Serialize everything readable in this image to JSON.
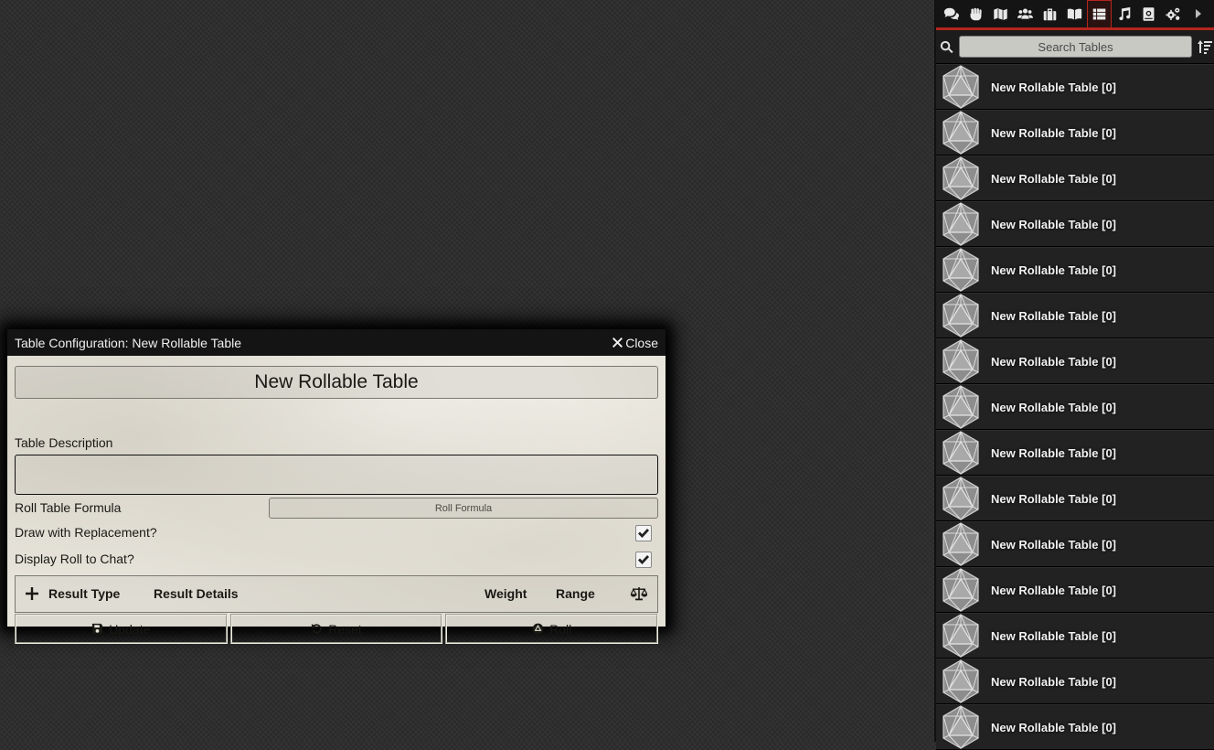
{
  "sidebar": {
    "tabs": [
      {
        "icon": "comments-icon",
        "name": "chat"
      },
      {
        "icon": "fist-icon",
        "name": "combat"
      },
      {
        "icon": "map-icon",
        "name": "scenes"
      },
      {
        "icon": "users-icon",
        "name": "actors"
      },
      {
        "icon": "suitcase-icon",
        "name": "items"
      },
      {
        "icon": "book-open-icon",
        "name": "journal"
      },
      {
        "icon": "th-list-icon",
        "name": "tables",
        "active": true
      },
      {
        "icon": "music-icon",
        "name": "playlists"
      },
      {
        "icon": "atlas-icon",
        "name": "compendium"
      },
      {
        "icon": "cogs-icon",
        "name": "settings"
      }
    ],
    "search": {
      "placeholder": "Search Tables",
      "value": ""
    },
    "entries": [
      {
        "label": "New Rollable Table [0]"
      },
      {
        "label": "New Rollable Table [0]"
      },
      {
        "label": "New Rollable Table [0]"
      },
      {
        "label": "New Rollable Table [0]"
      },
      {
        "label": "New Rollable Table [0]"
      },
      {
        "label": "New Rollable Table [0]"
      },
      {
        "label": "New Rollable Table [0]"
      },
      {
        "label": "New Rollable Table [0]"
      },
      {
        "label": "New Rollable Table [0]"
      },
      {
        "label": "New Rollable Table [0]"
      },
      {
        "label": "New Rollable Table [0]"
      },
      {
        "label": "New Rollable Table [0]"
      },
      {
        "label": "New Rollable Table [0]"
      },
      {
        "label": "New Rollable Table [0]"
      },
      {
        "label": "New Rollable Table [0]"
      }
    ]
  },
  "window": {
    "title": "Table Configuration: New Rollable Table",
    "close_label": "Close",
    "name_value": "New Rollable Table",
    "description_label": "Table Description",
    "formula_label": "Roll Table Formula",
    "formula_placeholder": "Roll Formula",
    "replacement_label": "Draw with Replacement?",
    "replacement_checked": true,
    "display_label": "Display Roll to Chat?",
    "display_checked": true,
    "results_header": {
      "type": "Result Type",
      "details": "Result Details",
      "weight": "Weight",
      "range": "Range"
    },
    "buttons": {
      "update": "Update",
      "reset": "Reset",
      "roll": "Roll"
    }
  },
  "colors": {
    "accent": "#b3261e",
    "sidebar_bg": "#1c1c1c",
    "window_bg": "#e8e5dc"
  }
}
